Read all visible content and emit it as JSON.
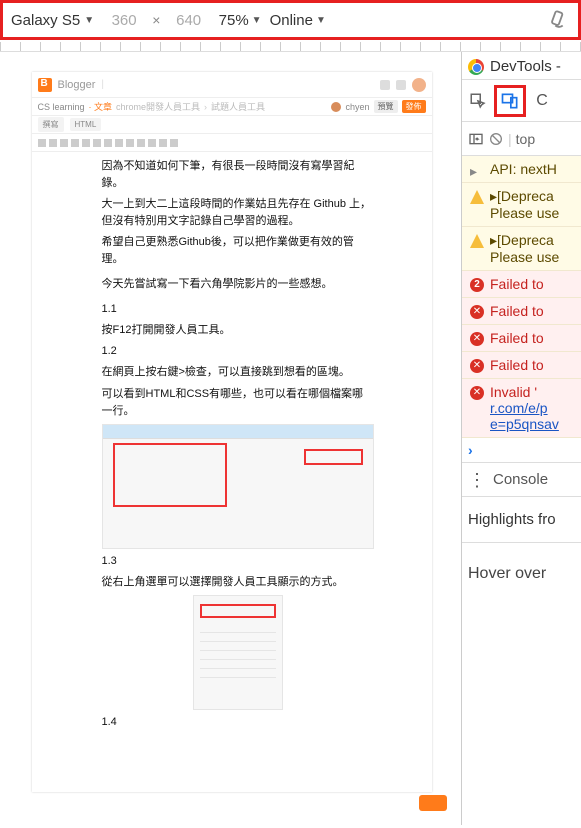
{
  "device_toolbar": {
    "device": "Galaxy S5",
    "width": "360",
    "height": "640",
    "zoom": "75%",
    "throttle": "Online"
  },
  "blogger": {
    "brand": "Blogger",
    "subtitle_left": "CS learning",
    "subtitle_orange": "· 文章",
    "crumb1": "chrome開發人員工具",
    "crumb2": "試題人員工具",
    "right_name": "chyen",
    "tab1": "撰寫",
    "tab2": "HTML",
    "body": {
      "p1": "因為不知道如何下筆，有很長一段時間沒有寫學習紀錄。",
      "p2": "大一上到大二上這段時間的作業姑且先存在 Github 上，但沒有特別用文字記錄自己學習的過程。",
      "p3": "希望自己更熟悉Github後，可以把作業做更有效的管理。",
      "p4": "今天先嘗試寫一下看六角學院影片的一些感想。",
      "s11": "1.1",
      "s11b": "按F12打開開發人員工具。",
      "s12": "1.2",
      "s12b": "在網頁上按右鍵>檢查，可以直接跳到想看的區塊。",
      "s12c": "可以看到HTML和CSS有哪些，也可以看在哪個檔案哪一行。",
      "s13": "1.3",
      "s13b": "從右上角選單可以選擇開發人員工具顯示的方式。",
      "s14": "1.4"
    }
  },
  "devtools": {
    "title": "DevTools -",
    "context": "top",
    "messages": {
      "api_line": "API: nextH",
      "dep1a": "[Depreca",
      "dep1b": "Please use",
      "dep2a": "[Depreca",
      "dep2b": "Please use",
      "fail_count": "2",
      "fail1": "Failed to",
      "fail2": "Failed to",
      "fail3": "Failed to",
      "fail4": "Failed to",
      "inv1": "Invalid '",
      "inv_link1": "r.com/e/p",
      "inv_link2": "e=p5qnsav"
    },
    "drawer_label": "Console",
    "highlights": "Highlights fro",
    "hover": "Hover over"
  }
}
